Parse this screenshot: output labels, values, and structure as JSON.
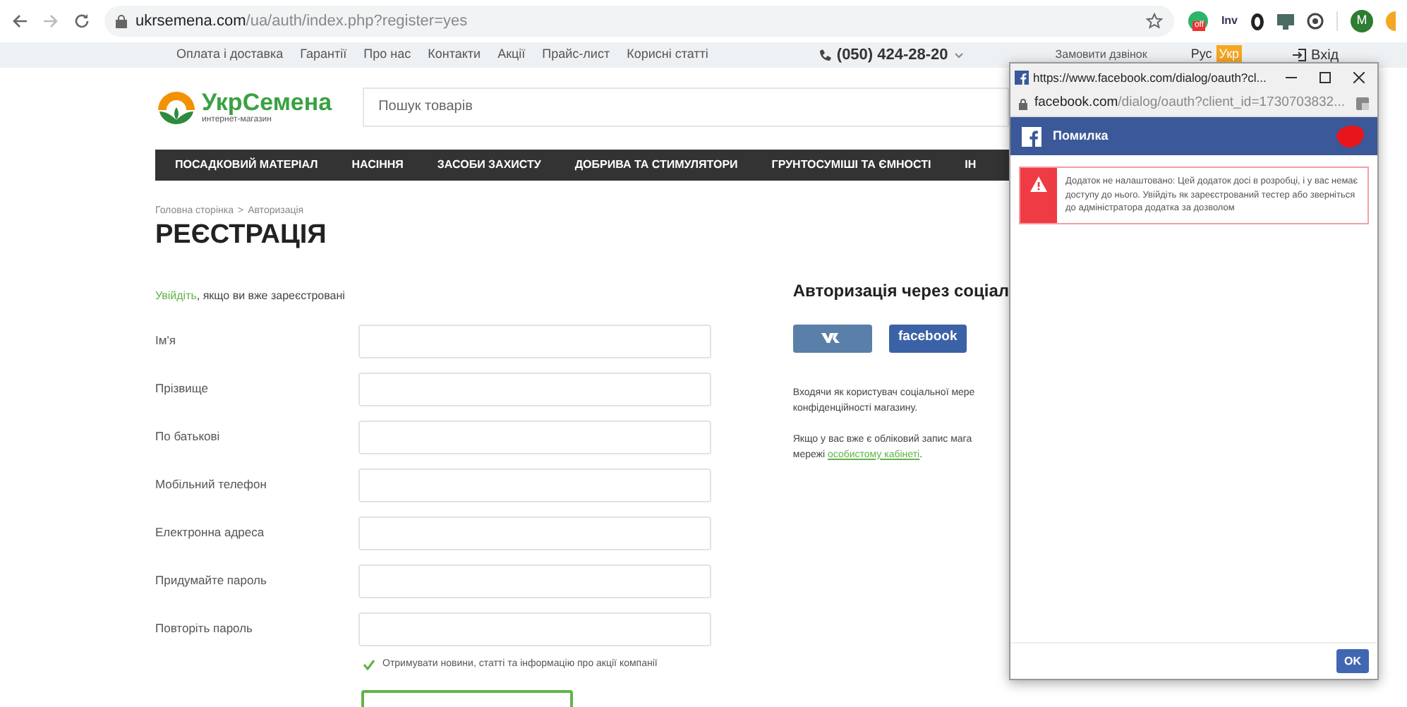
{
  "browser": {
    "url_host": "ukrsemena.com",
    "url_path": "/ua/auth/index.php?register=yes",
    "extension_badge": "off",
    "extension_label": "Inv",
    "profile_initial": "M"
  },
  "top_bar": {
    "links": [
      "Оплата і доставка",
      "Гарантії",
      "Про нас",
      "Контакти",
      "Акції",
      "Прайс-лист",
      "Корисні статті"
    ],
    "phone": "(050) 424-28-20",
    "callback": "Замовити дзвінок",
    "languages": [
      {
        "label": "Рус",
        "selected": false
      },
      {
        "label": "Укр",
        "selected": true
      }
    ],
    "login": "Вхід"
  },
  "header": {
    "logo_title": "УкрСемена",
    "logo_subtitle": "интернет-магазин",
    "search": {
      "placeholder": "Пошук товарів"
    }
  },
  "nav": [
    "ПОСАДКОВИЙ МАТЕРІАЛ",
    "НАСІННЯ",
    "ЗАСОБИ ЗАХИСТУ",
    "ДОБРИВА ТА СТИМУЛЯТОРИ",
    "ГРУНТОСУМІШІ ТА ЄМНОСТІ",
    "ІН"
  ],
  "breadcrumb": {
    "items": [
      "Головна сторінка",
      "Авторизація"
    ],
    "separator": ">"
  },
  "title": "РЕЄСТРАЦІЯ",
  "login_prompt": {
    "link": "Увійдіть",
    "rest": ", якщо ви вже зареєстровані"
  },
  "fields": [
    {
      "label": "Ім'я"
    },
    {
      "label": "Прізвище"
    },
    {
      "label": "По батькові"
    },
    {
      "label": "Мобільний телефон"
    },
    {
      "label": "Електронна адреса"
    },
    {
      "label": "Придумайте пароль"
    },
    {
      "label": "Повторіть пароль"
    }
  ],
  "newsletter": {
    "label": "Отримувати новини, статті та інформацію про акції компанії",
    "checked": true
  },
  "social": {
    "title": "Авторизація через соціал",
    "buttons": [
      {
        "kind": "vk"
      },
      {
        "kind": "facebook",
        "label": "facebook"
      }
    ],
    "notes": [
      {
        "lines": [
          "Входячи як користувач соціальної мере",
          "конфіденційності магазину."
        ]
      },
      {
        "lines": [
          "Якщо у вас вже є обліковий запис мага"
        ],
        "lead": "мережі ",
        "link": "особистому кабінеті",
        "tail": "."
      }
    ]
  },
  "popup": {
    "title_url": "https://www.facebook.com/dialog/oauth?cl...",
    "address_host": "facebook.com",
    "address_rest": "/dialog/oauth?client_id=1730703832...",
    "header": "Помилка",
    "error": "Додаток не налаштовано: Цей додаток досі в розробці, і у вас немає доступу до нього. Увійдіть як зареєстрований тестер або зверніться до адміністратора додатка за дозволом",
    "ok": "OK"
  }
}
